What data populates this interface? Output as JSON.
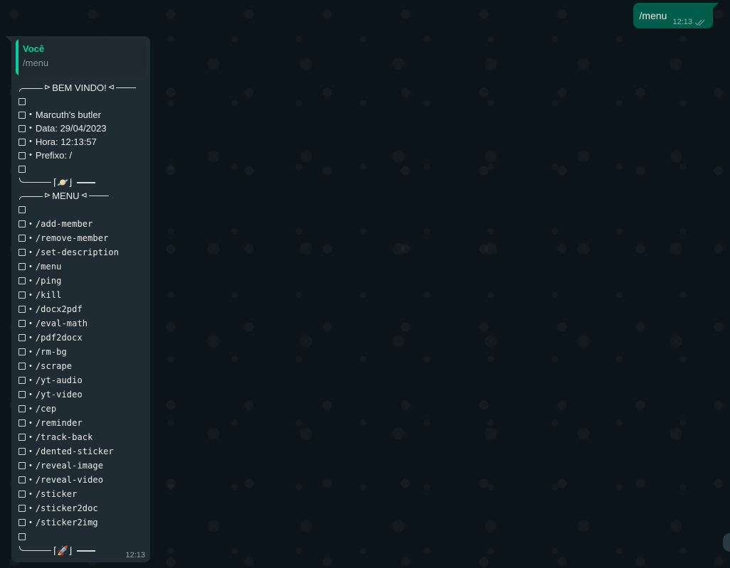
{
  "outgoing": {
    "text": "/menu",
    "time": "12:13",
    "status_icon": "double-check-icon"
  },
  "incoming": {
    "quote_author": "Você",
    "quote_text": "/menu",
    "welcome": {
      "title": "BEM VINDO!",
      "lines": [
        "",
        "Marcuth's butler",
        "Data: 29/04/2023",
        "Hora: 12:13:57",
        "Prefixo: /",
        ""
      ],
      "footer_emoji": "🪐"
    },
    "menu": {
      "title": "MENU",
      "commands": [
        "",
        "/add-member",
        "/remove-member",
        "/set-description",
        "/menu",
        "/ping",
        "/kill",
        "/docx2pdf",
        "/eval-math",
        "/pdf2docx",
        "/rm-bg",
        "/scrape",
        "/yt-audio",
        "/yt-video",
        "/cep",
        "/reminder",
        "/track-back",
        "/dented-sticker",
        "/reveal-image",
        "/reveal-video",
        "/sticker",
        "/sticker2doc",
        "/sticker2img",
        ""
      ],
      "footer_emoji": "🚀"
    },
    "time": "12:13"
  },
  "colors": {
    "background": "#0b141a",
    "incoming_bubble": "#202c33",
    "outgoing_bubble": "#005c4b",
    "quote_accent": "#06cf9c"
  }
}
